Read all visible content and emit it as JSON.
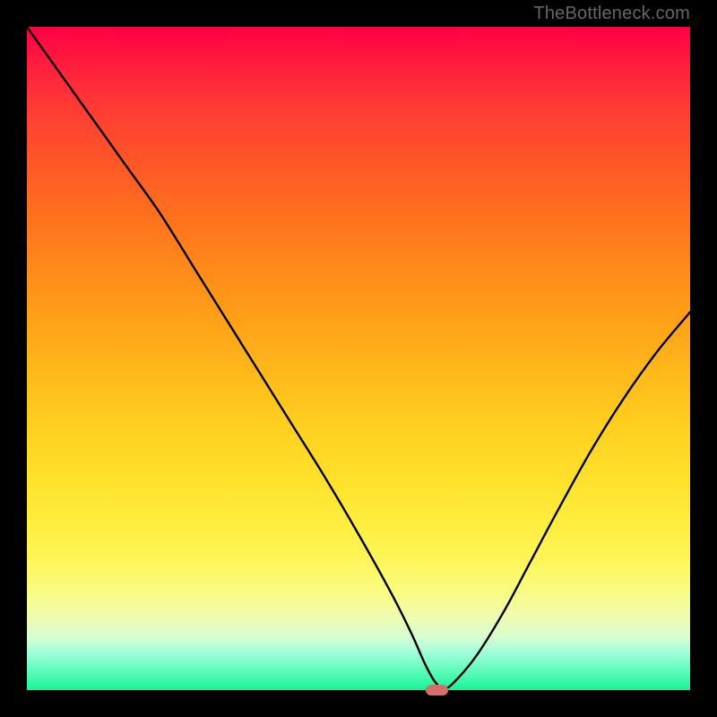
{
  "watermark": "TheBottleneck.com",
  "colors": {
    "frame": "#000000",
    "curve": "#000000",
    "marker": "#d86e6a"
  },
  "chart_data": {
    "type": "line",
    "title": "",
    "xlabel": "",
    "ylabel": "",
    "xlim": [
      0,
      100
    ],
    "ylim": [
      0,
      100
    ],
    "series": [
      {
        "name": "bottleneck-curve",
        "x": [
          0,
          5,
          10,
          15,
          20,
          25,
          30,
          35,
          40,
          45,
          50,
          55,
          58,
          60,
          61.5,
          63,
          65,
          68,
          72,
          76,
          80,
          85,
          90,
          95,
          100
        ],
        "y": [
          100,
          93,
          86,
          79,
          72,
          64,
          56,
          48,
          40,
          32,
          23.5,
          14.5,
          8.5,
          4,
          1.3,
          0.2,
          1.8,
          5.5,
          12,
          19.5,
          27,
          36,
          44,
          51,
          57
        ]
      }
    ],
    "marker": {
      "x": 61.8,
      "y": 0.0,
      "w": 3.3,
      "h": 1.6
    },
    "grid": false,
    "legend": false
  }
}
